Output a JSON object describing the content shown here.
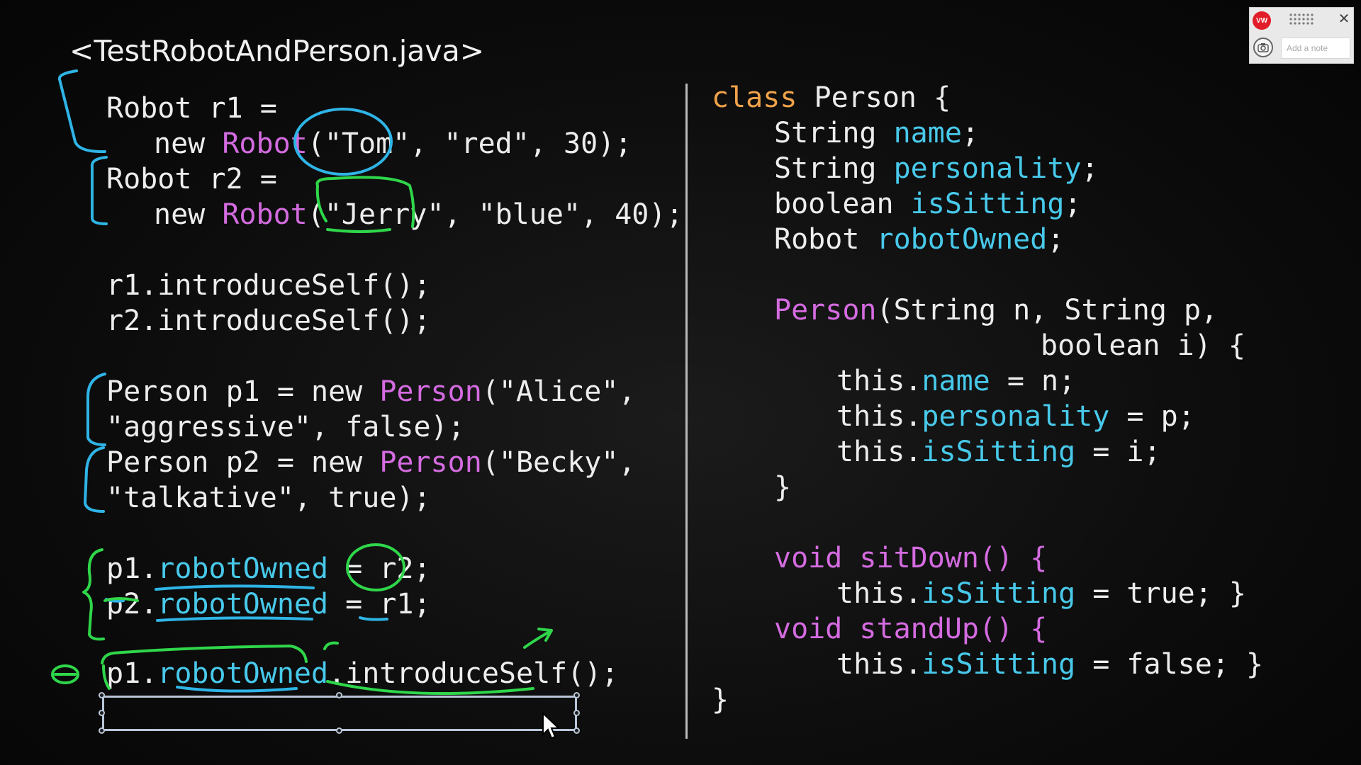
{
  "file_title": "<TestRobotAndPerson.java>",
  "left_code": [
    {
      "tokens": [
        {
          "t": "Robot r1 =",
          "c": ""
        }
      ]
    },
    {
      "tokens": [
        {
          "t": "new ",
          "c": ""
        },
        {
          "t": "Robot",
          "c": "pink"
        },
        {
          "t": "(\"Tom\", \"red\", 30);",
          "c": ""
        }
      ]
    },
    {
      "tokens": [
        {
          "t": "Robot r2 =",
          "c": ""
        }
      ]
    },
    {
      "tokens": [
        {
          "t": "new ",
          "c": ""
        },
        {
          "t": "Robot",
          "c": "pink"
        },
        {
          "t": "(\"Jerry\", \"blue\", 40);",
          "c": ""
        }
      ]
    },
    {
      "tokens": [
        {
          "t": "r1.introduceSelf();",
          "c": ""
        }
      ]
    },
    {
      "tokens": [
        {
          "t": "r2.introduceSelf();",
          "c": ""
        }
      ]
    },
    {
      "tokens": [
        {
          "t": "Person p1 = new ",
          "c": ""
        },
        {
          "t": "Person",
          "c": "pink"
        },
        {
          "t": "(\"Alice\",",
          "c": ""
        }
      ]
    },
    {
      "tokens": [
        {
          "t": "\"aggressive\", false);",
          "c": ""
        }
      ]
    },
    {
      "tokens": [
        {
          "t": "Person p2 = new ",
          "c": ""
        },
        {
          "t": "Person",
          "c": "pink"
        },
        {
          "t": "(\"Becky\",",
          "c": ""
        }
      ]
    },
    {
      "tokens": [
        {
          "t": "\"talkative\", true);",
          "c": ""
        }
      ]
    },
    {
      "tokens": [
        {
          "t": "p1.",
          "c": ""
        },
        {
          "t": "robotOwned",
          "c": "cyan"
        },
        {
          "t": " = r2;",
          "c": ""
        }
      ]
    },
    {
      "tokens": [
        {
          "t": "p2.",
          "c": ""
        },
        {
          "t": "robotOwned",
          "c": "cyan"
        },
        {
          "t": " = r1;",
          "c": ""
        }
      ]
    },
    {
      "tokens": [
        {
          "t": "p1.",
          "c": ""
        },
        {
          "t": "robotOwned",
          "c": "cyan"
        },
        {
          "t": ".introduceSelf();",
          "c": ""
        }
      ]
    }
  ],
  "right_code": [
    {
      "tokens": [
        {
          "t": "class",
          "c": "kw"
        },
        {
          "t": " Person {",
          "c": ""
        }
      ]
    },
    {
      "tokens": [
        {
          "t": "String ",
          "c": ""
        },
        {
          "t": "name",
          "c": "cyan"
        },
        {
          "t": ";",
          "c": ""
        }
      ]
    },
    {
      "tokens": [
        {
          "t": "String ",
          "c": ""
        },
        {
          "t": "personality",
          "c": "cyan"
        },
        {
          "t": ";",
          "c": ""
        }
      ]
    },
    {
      "tokens": [
        {
          "t": "boolean ",
          "c": ""
        },
        {
          "t": "isSitting",
          "c": "cyan"
        },
        {
          "t": ";",
          "c": ""
        }
      ]
    },
    {
      "tokens": [
        {
          "t": "Robot ",
          "c": ""
        },
        {
          "t": "robotOwned",
          "c": "cyan"
        },
        {
          "t": ";",
          "c": ""
        }
      ]
    },
    {
      "tokens": [
        {
          "t": "Person",
          "c": "pink"
        },
        {
          "t": "(String n, String p,",
          "c": ""
        }
      ]
    },
    {
      "tokens": [
        {
          "t": "boolean i) {",
          "c": ""
        }
      ]
    },
    {
      "tokens": [
        {
          "t": "this.",
          "c": ""
        },
        {
          "t": "name",
          "c": "cyan"
        },
        {
          "t": " = n;",
          "c": ""
        }
      ]
    },
    {
      "tokens": [
        {
          "t": "this.",
          "c": ""
        },
        {
          "t": "personality",
          "c": "cyan"
        },
        {
          "t": " = p;",
          "c": ""
        }
      ]
    },
    {
      "tokens": [
        {
          "t": "this.",
          "c": ""
        },
        {
          "t": "isSitting",
          "c": "cyan"
        },
        {
          "t": " = i;",
          "c": ""
        }
      ]
    },
    {
      "tokens": [
        {
          "t": "}",
          "c": ""
        }
      ]
    },
    {
      "tokens": [
        {
          "t": "void sitDown() {",
          "c": "pink"
        }
      ]
    },
    {
      "tokens": [
        {
          "t": "this.",
          "c": ""
        },
        {
          "t": "isSitting",
          "c": "cyan"
        },
        {
          "t": " = true; }",
          "c": ""
        }
      ]
    },
    {
      "tokens": [
        {
          "t": "void standUp() {",
          "c": "pink"
        }
      ]
    },
    {
      "tokens": [
        {
          "t": "this.",
          "c": ""
        },
        {
          "t": "isSitting",
          "c": "cyan"
        },
        {
          "t": " = false; }",
          "c": ""
        }
      ]
    },
    {
      "tokens": [
        {
          "t": "}",
          "c": ""
        }
      ]
    }
  ],
  "widget": {
    "logo_text": "VW",
    "note_placeholder": "Add a note",
    "close_glyph": "✕"
  },
  "colors": {
    "keyword": "#f0a24a",
    "class_name": "#d46be0",
    "field": "#48c9ea",
    "ink_blue": "#2fb4e6",
    "ink_green": "#2fd64a",
    "selection": "#b8c6d8"
  }
}
